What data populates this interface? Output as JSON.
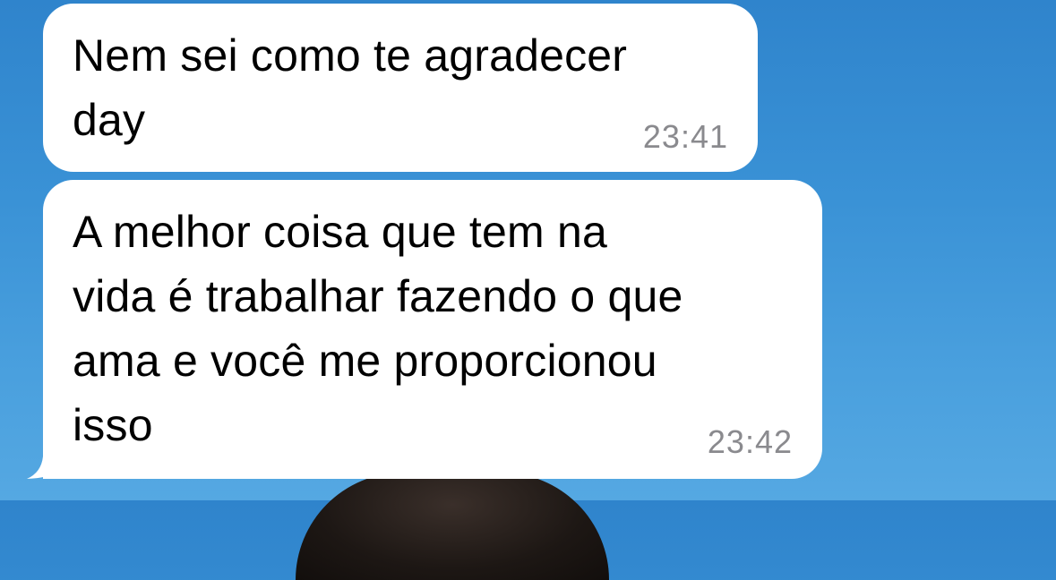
{
  "conversation": {
    "messages": [
      {
        "lines": [
          "Nem sei como te agradecer",
          "day"
        ],
        "time": "23:41"
      },
      {
        "lines": [
          "A melhor coisa que tem na",
          "vida é trabalhar fazendo o que",
          "ama e você me proporcionou",
          "isso"
        ],
        "time": "23:42"
      }
    ]
  },
  "colors": {
    "bubble_incoming": "#ffffff",
    "timestamp": "#8a8a8e",
    "wallpaper": "#3a92d6"
  }
}
